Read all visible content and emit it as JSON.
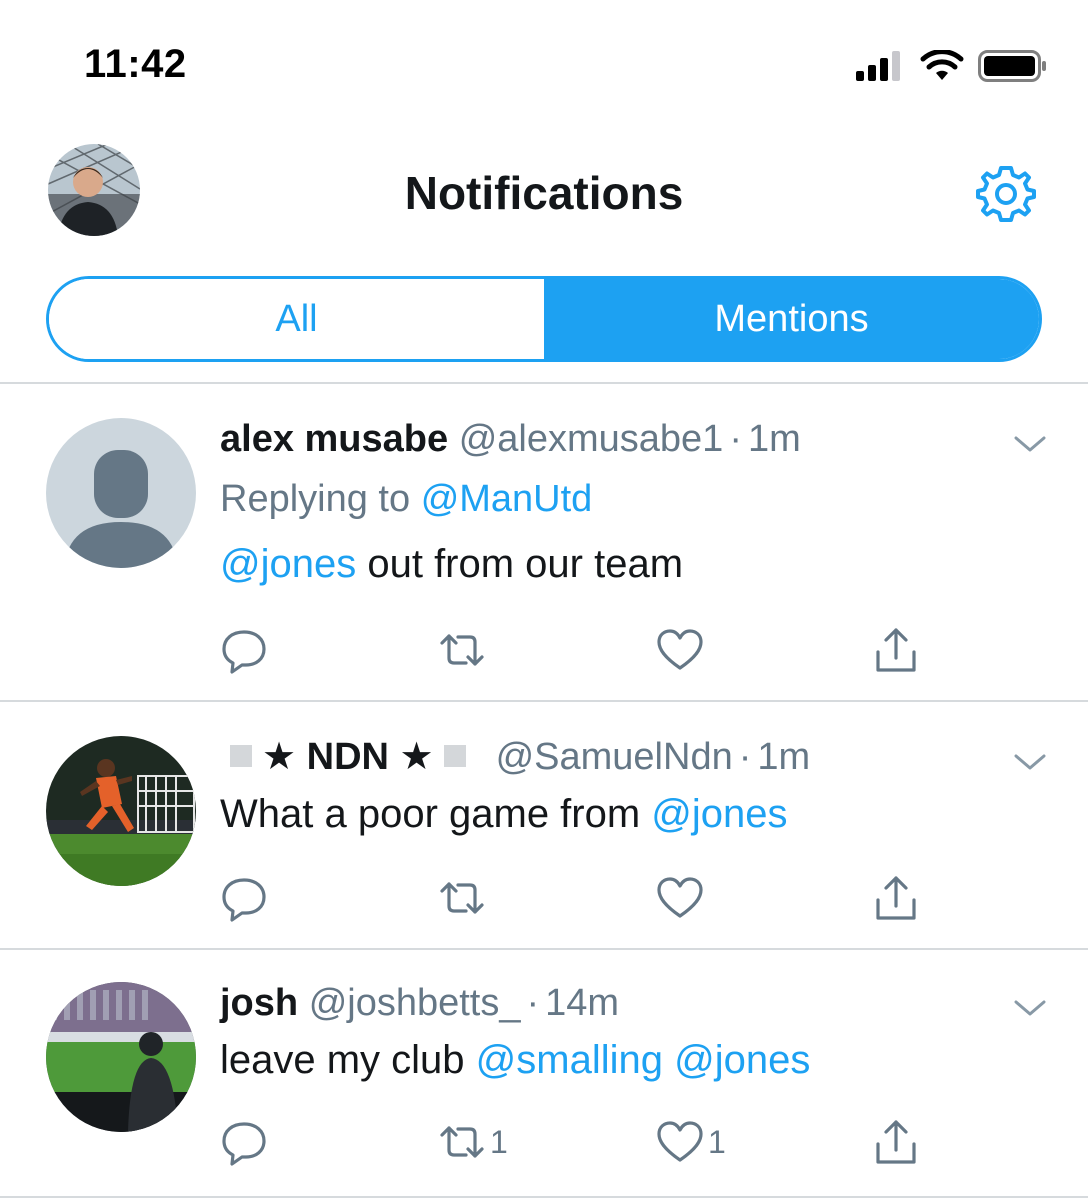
{
  "status_bar": {
    "time": "11:42"
  },
  "header": {
    "title": "Notifications"
  },
  "tabs": [
    {
      "label": "All",
      "selected": false
    },
    {
      "label": "Mentions",
      "selected": true
    }
  ],
  "colors": {
    "accent": "#1da1f2",
    "text": "#14171a",
    "secondary": "#657786",
    "divider": "#d6dadd"
  },
  "tweets": [
    {
      "name": "alex musabe",
      "handle": "@alexmusabe1",
      "separator": "·",
      "time": "1m",
      "replying_label": "Replying to",
      "replying_to": "@ManUtd",
      "mention": "@jones",
      "text": " out from our team",
      "retweet_count": "",
      "like_count": ""
    },
    {
      "name": "★ NDN ★",
      "handle": "@SamuelNdn",
      "separator": "·",
      "time": "1m",
      "text": "What a poor game from ",
      "mention": "@jones",
      "retweet_count": "",
      "like_count": ""
    },
    {
      "name": "josh",
      "handle": "@joshbetts_",
      "separator": "·",
      "time": "14m",
      "text": "leave my club ",
      "mention1": "@smalling",
      "mention2": "@jones",
      "retweet_count": "1",
      "like_count": "1"
    }
  ],
  "icons": [
    "signal-icon",
    "wifi-icon",
    "battery-icon",
    "gear-icon",
    "reply-icon",
    "retweet-icon",
    "like-icon",
    "share-icon",
    "chevron-down-icon"
  ]
}
